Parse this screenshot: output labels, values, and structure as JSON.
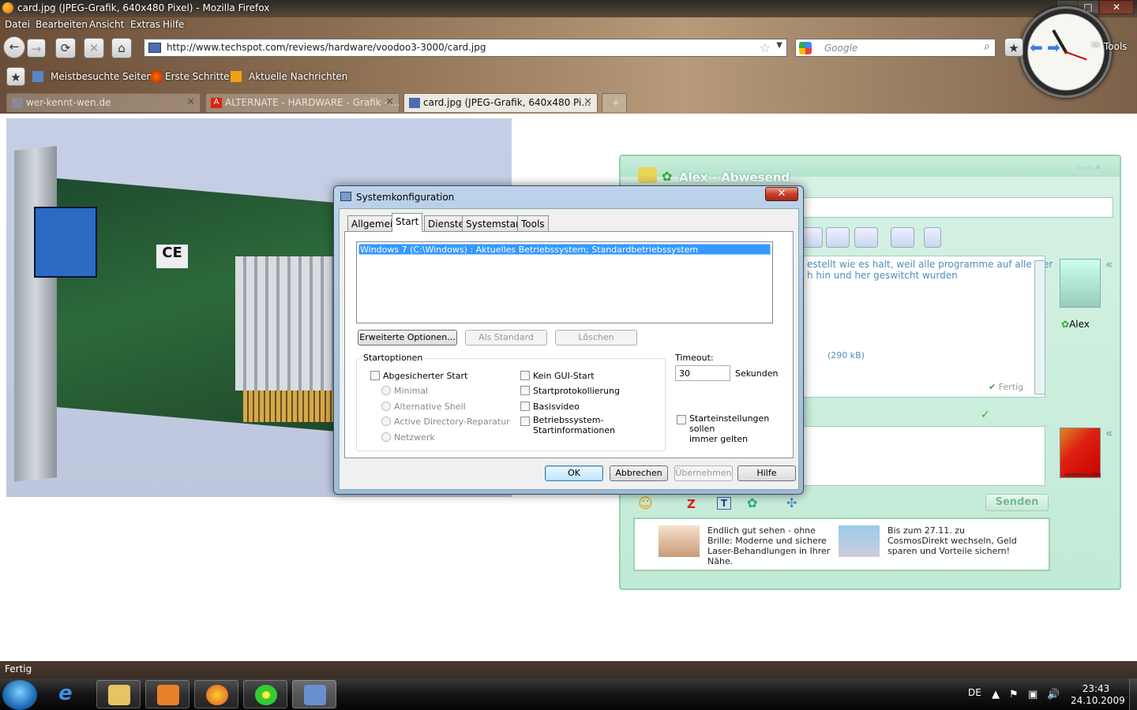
{
  "window": {
    "title": "card.jpg (JPEG-Grafik, 640x480 Pixel) - Mozilla Firefox",
    "minimize": "–",
    "maximize": "□",
    "close": "✕"
  },
  "menu": [
    "Datei",
    "Bearbeiten",
    "Ansicht",
    "Extras",
    "Hilfe"
  ],
  "nav": {
    "url": "http://www.techspot.com/reviews/hardware/voodoo3-3000/card.jpg",
    "search_placeholder": "Google",
    "tools_label": "Tools",
    "back": "←",
    "forward": "→",
    "reload": "⟳",
    "stop": "✕",
    "home": "⌂"
  },
  "bookmarks": [
    "Meistbesuchte Seiten",
    "Erste Schritte",
    "Aktuelle Nachrichten"
  ],
  "tabs": [
    {
      "label": "wer-kennt-wen.de",
      "active": false
    },
    {
      "label": "ALTERNATE - HARDWARE - Grafik - ...",
      "active": false
    },
    {
      "label": "card.jpg (JPEG-Grafik, 640x480 Pi...",
      "active": true
    }
  ],
  "tab_new": "+",
  "card": {
    "ce_mark": "CE"
  },
  "msconfig": {
    "title": "Systemkonfiguration",
    "close": "✕",
    "tabs": [
      "Allgemein",
      "Start",
      "Dienste",
      "Systemstart",
      "Tools"
    ],
    "selected_tab": "Start",
    "os_entry": "Windows 7 (C:\\Windows) : Aktuelles Betriebssystem; Standardbetriebssystem",
    "buttons": {
      "advanced": "Erweiterte Optionen...",
      "default": "Als Standard",
      "delete": "Löschen"
    },
    "boot_options_label": "Startoptionen",
    "safe_boot": "Abgesicherter Start",
    "safe_modes": [
      "Minimal",
      "Alternative Shell",
      "Active Directory-Reparatur",
      "Netzwerk"
    ],
    "no_gui": "Kein GUI-Start",
    "boot_log": "Startprotokollierung",
    "base_video": "Basisvideo",
    "os_boot_info": "Betriebssystem-\nStartinformationen",
    "timeout_label": "Timeout:",
    "timeout_value": "30",
    "timeout_unit": "Sekunden",
    "permanent": "Starteinstellungen sollen\nimmer gelten",
    "footer": {
      "ok": "OK",
      "cancel": "Abbrechen",
      "apply": "Übernehmen",
      "help": "Hilfe"
    }
  },
  "icq": {
    "title": "Alex - Abwesend",
    "chat_lines": [
      "estellt wie es halt, weil alle programme auf alle vier",
      "h hin und her geswitcht wurden"
    ],
    "file_size": "(290 kB)",
    "status_done": "Fertig",
    "contact_name": "Alex",
    "send": "Senden",
    "flag_caption": "sweetim.com",
    "ads": [
      "Endlich gut sehen - ohne Brille: Moderne und sichere Laser-Behandlungen in Ihrer Nähe.",
      "Bis zum 27.11. zu CosmosDirekt wechseln, Geld sparen und Vorteile sichern!"
    ],
    "collapse": "«"
  },
  "status": "Fertig",
  "taskbar": {
    "lang": "DE",
    "time": "23:43",
    "date": "24.10.2009"
  },
  "colors": {
    "accent": "#3399ff",
    "icq_green": "#8fd4b2"
  }
}
